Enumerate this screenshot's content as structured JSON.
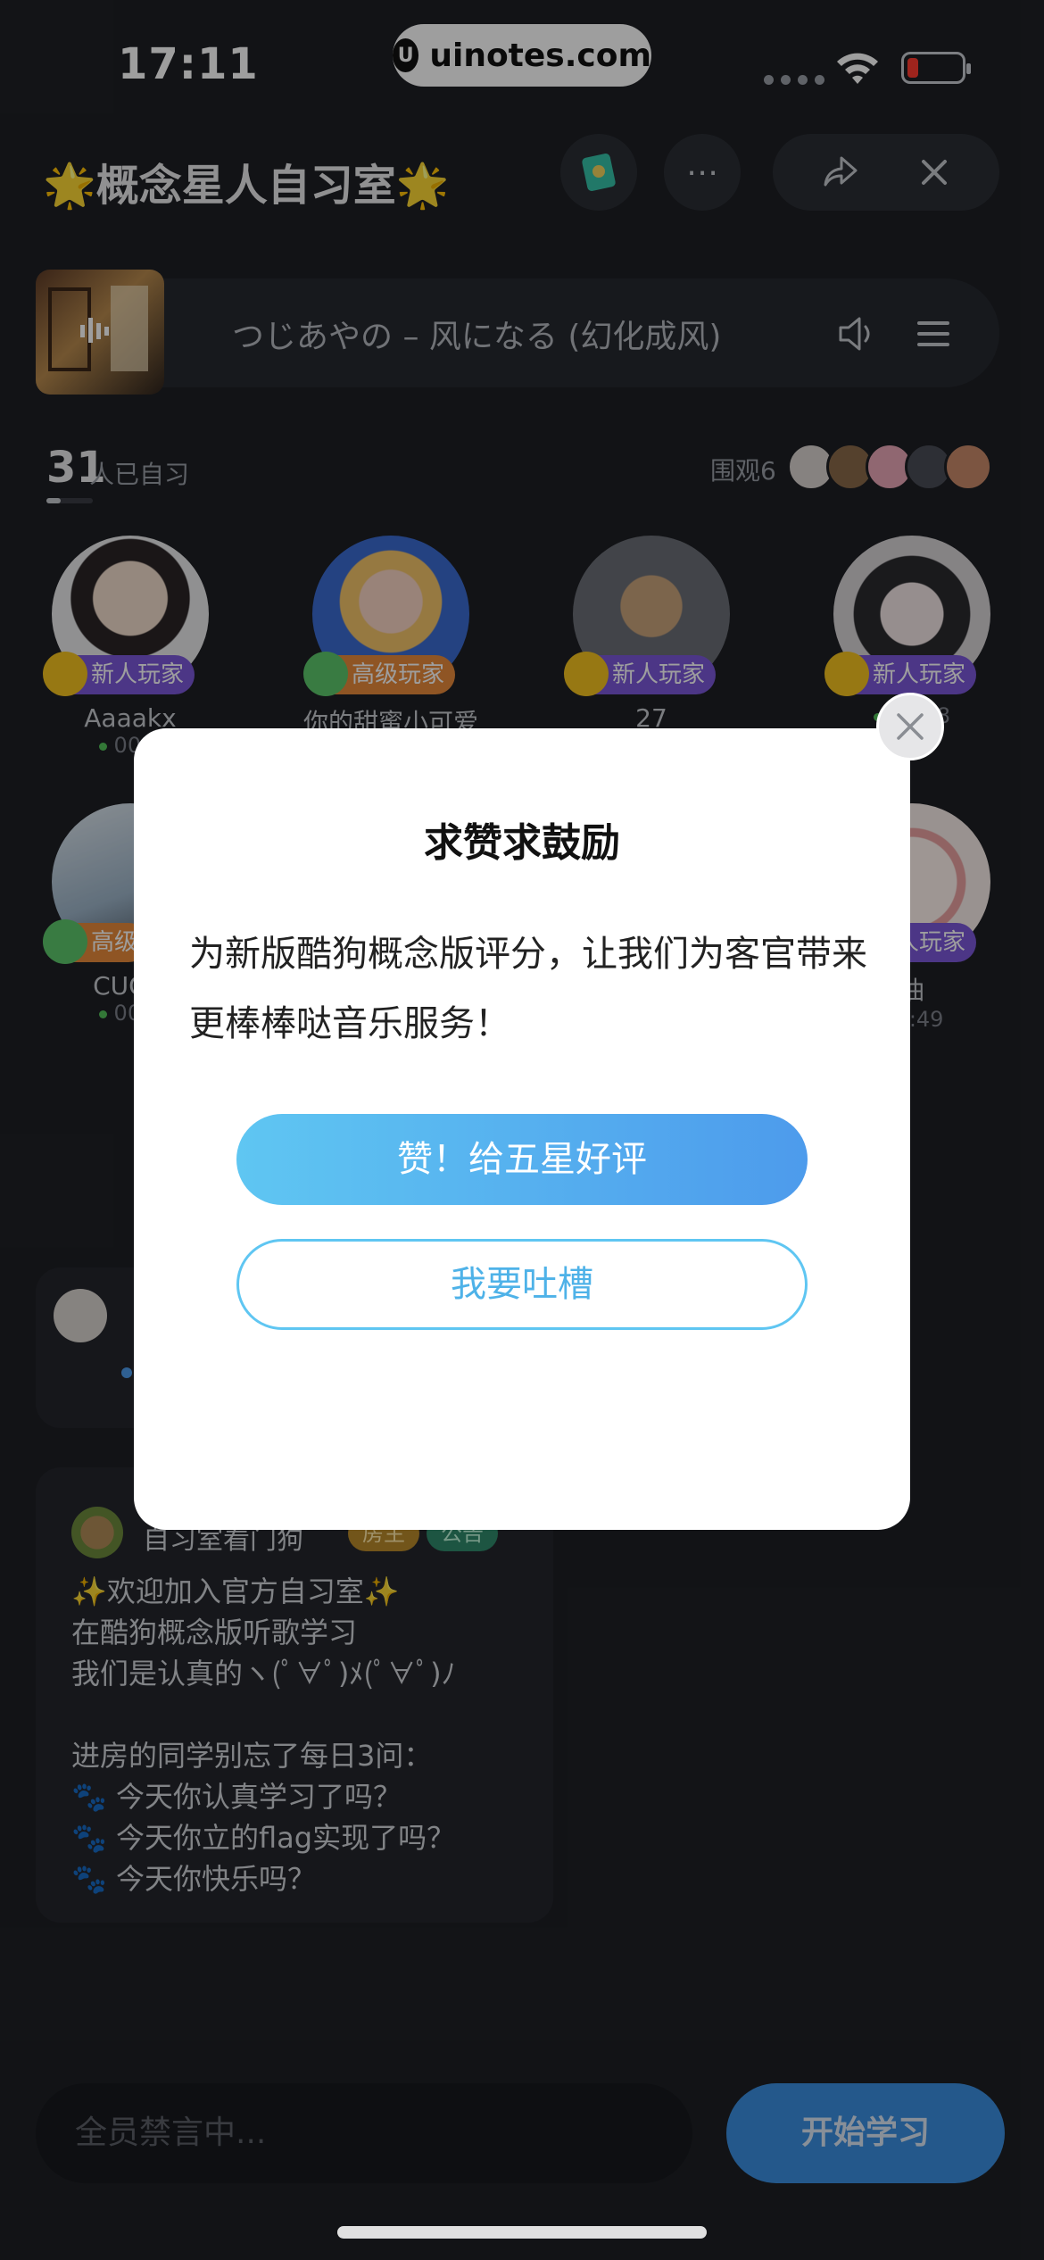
{
  "status": {
    "time": "17:11",
    "watermark": "uinotes.com"
  },
  "header": {
    "title": "🌟概念星人自习室🌟"
  },
  "music": {
    "song": "つじあやの – 风になる (幻化成风)"
  },
  "members": {
    "count": "31",
    "count_label": "人已自习",
    "watch_label": "围观6",
    "list": [
      {
        "name": "Aaaakx",
        "time": "00:0",
        "badge": "新人玩家"
      },
      {
        "name": "你的甜蜜小可爱",
        "time": "",
        "badge": "高级玩家"
      },
      {
        "name": "27",
        "time": "",
        "badge": "新人玩家"
      },
      {
        "name": "",
        "time": "23:48",
        "badge": "新人玩家"
      },
      {
        "name": "CUGO",
        "time": "00:2",
        "badge": "高级"
      },
      {
        "name": "油",
        "time": "5:49",
        "badge": "新人玩家"
      }
    ]
  },
  "announcement": {
    "owner": "自习室看门狗",
    "tags": [
      "房主",
      "公告"
    ],
    "text": "✨欢迎加入官方自习室✨\n在酷狗概念版听歌学习\n我们是认真的ヽ(ﾟ∀ﾟ)ﾒ(ﾟ∀ﾟ)ﾉ\n\n进房的同学别忘了每日3问：\n🐾 今天你认真学习了吗？\n🐾 今天你立的flag实现了吗？\n🐾 今天你快乐吗？"
  },
  "bottom": {
    "input_placeholder": "全员禁言中...",
    "start_label": "开始学习"
  },
  "modal": {
    "title": "求赞求鼓励",
    "message": "为新版酷狗概念版评分，让我们为客官带来更棒棒哒音乐服务！",
    "primary": "赞！给五星好评",
    "secondary": "我要吐槽"
  },
  "colors": {
    "accent": "#4d9bec",
    "badge": "#7b57d8",
    "background": "#1e2025"
  }
}
